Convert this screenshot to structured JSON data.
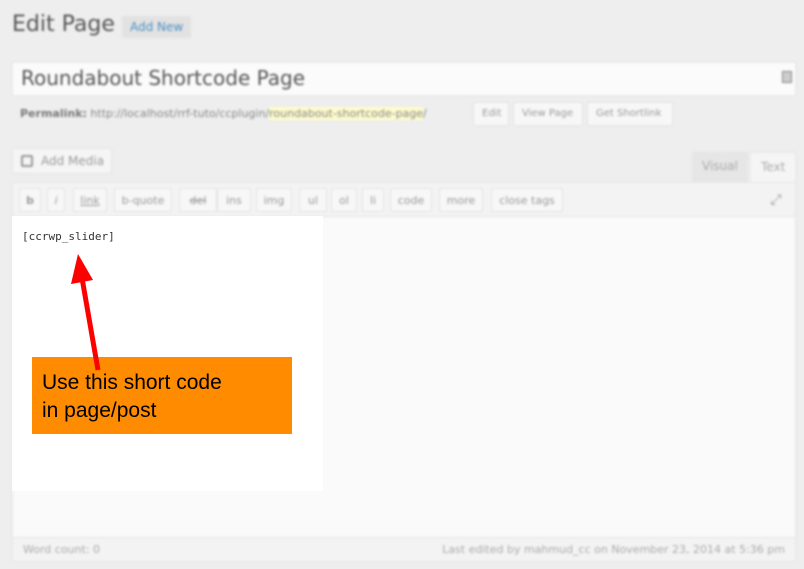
{
  "header": {
    "title": "Edit Page",
    "add_new_label": "Add New"
  },
  "post": {
    "title": "Roundabout Shortcode Page",
    "permalink_label": "Permalink:",
    "permalink_base": "http://localhost/rrf-tuto/ccplugin/",
    "permalink_slug": "roundabout-shortcode-page",
    "permalink_trailing": "/",
    "buttons": {
      "edit": "Edit",
      "view_page": "View Page",
      "get_shortlink": "Get Shortlink"
    }
  },
  "editor": {
    "add_media_label": "Add Media",
    "tabs": {
      "visual": "Visual",
      "text": "Text"
    },
    "quicktags": [
      "b",
      "i",
      "link",
      "b-quote",
      "del",
      "ins",
      "img",
      "ul",
      "ol",
      "li",
      "code",
      "more",
      "close tags"
    ],
    "content": "[ccrwp_slider]",
    "word_count": "Word count: 0",
    "last_edited": "Last edited by mahmud_cc on November 23, 2014 at 5:36 pm"
  },
  "annotation": {
    "callout_line1": "Use this short code",
    "callout_line2": "in page/post",
    "callout_color": "#ff8c00",
    "arrow_color": "#ff0000"
  },
  "icons": {
    "add_media": "media-icon",
    "fullscreen": "fullscreen-icon",
    "title_field": "form-field-icon"
  }
}
